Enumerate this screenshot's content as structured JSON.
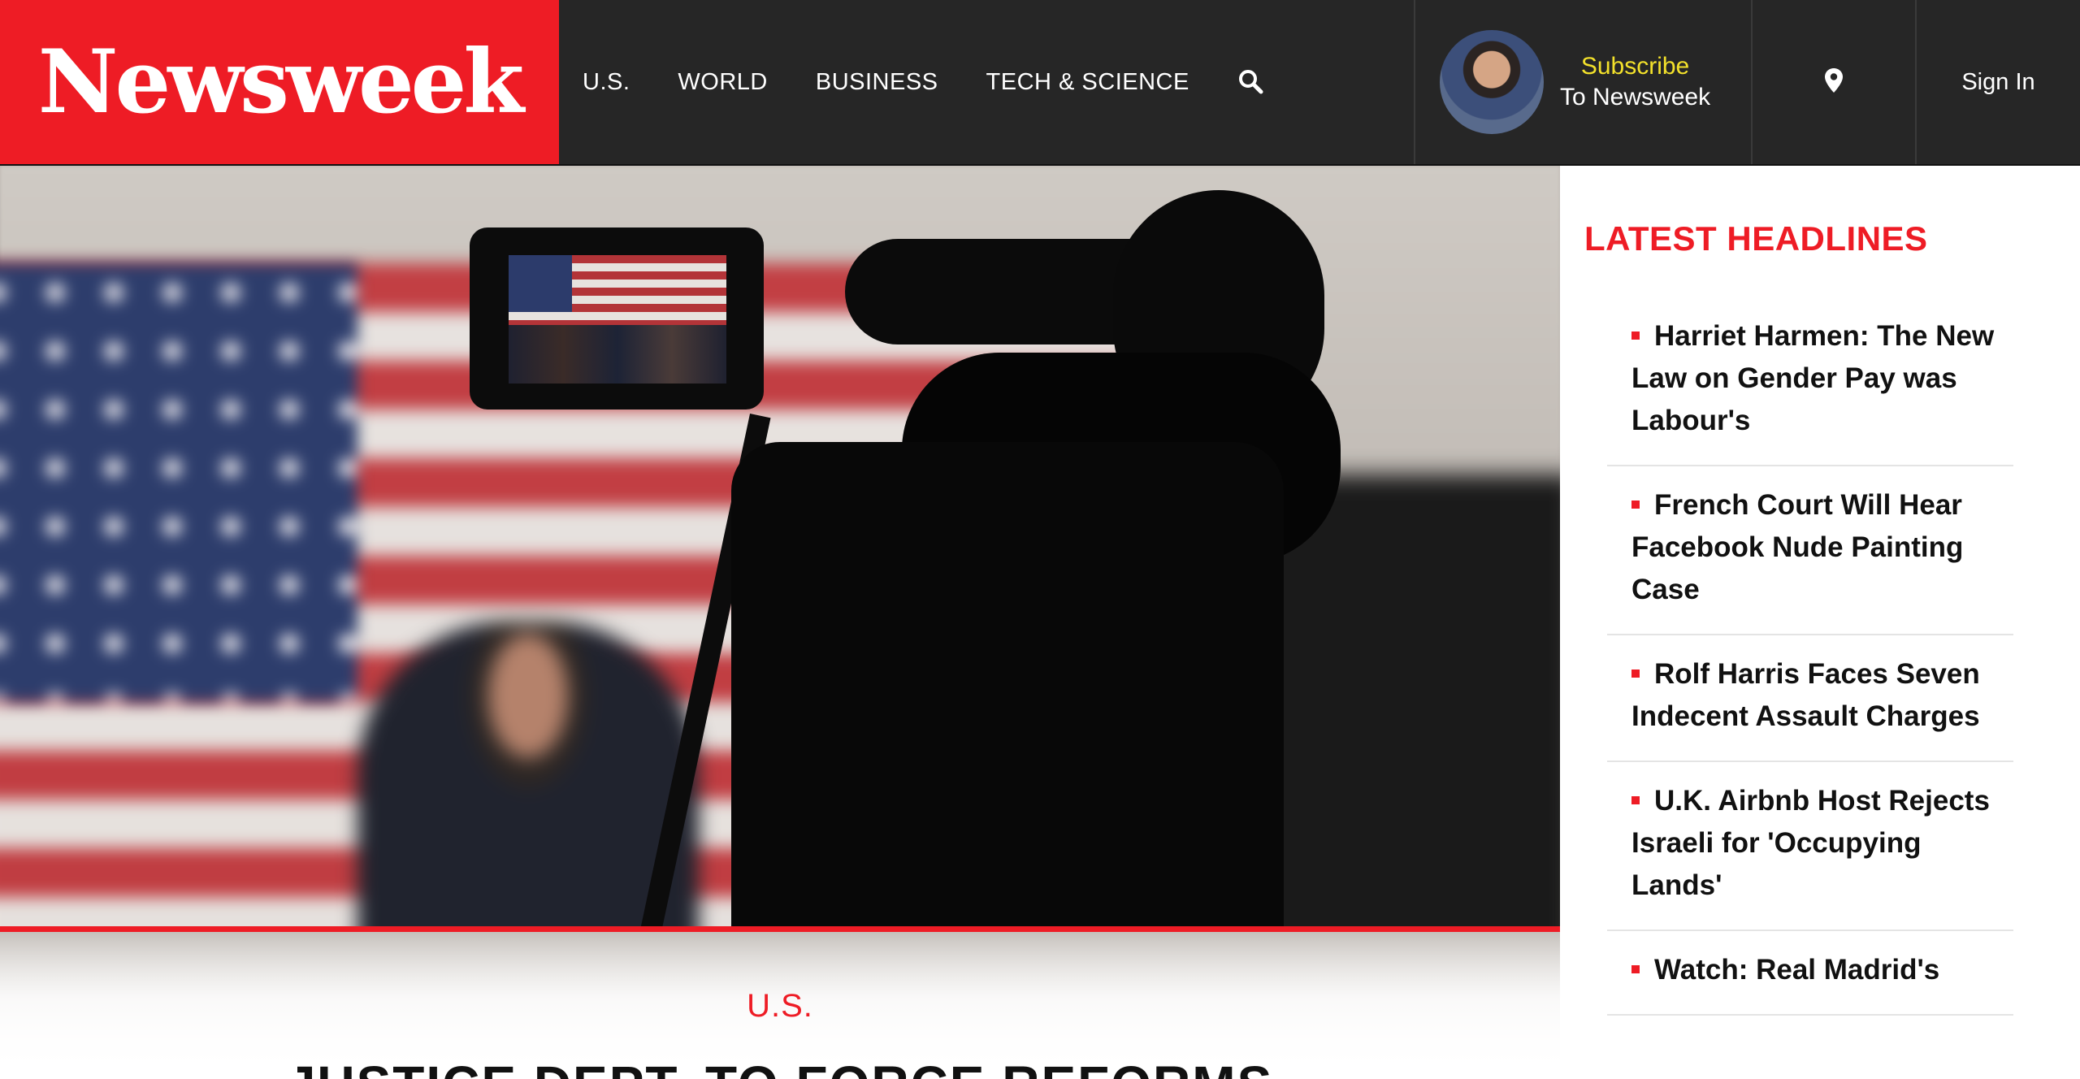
{
  "header": {
    "logo": "Newsweek",
    "nav": [
      {
        "label": "U.S."
      },
      {
        "label": "WORLD"
      },
      {
        "label": "BUSINESS"
      },
      {
        "label": "TECH & SCIENCE"
      }
    ],
    "search_icon": "search-icon",
    "subscribe": {
      "line1": "Subscribe",
      "line2": "To Newsweek"
    },
    "location_icon": "map-pin-icon",
    "sign_in": "Sign In"
  },
  "hero": {
    "section": "U.S.",
    "title": "JUSTICE DEPT. TO FORCE REFORMS"
  },
  "sidebar": {
    "title": "LATEST HEADLINES",
    "headlines": [
      "Harriet Harmen: The New Law on Gender Pay was Labour's",
      "French Court Will Hear Facebook Nude Painting Case",
      "Rolf Harris Faces Seven Indecent Assault Charges",
      "U.K. Airbnb Host Rejects Israeli for 'Occupying Lands'",
      "Watch: Real Madrid's"
    ]
  },
  "colors": {
    "brand_red": "#ee1c25",
    "header_bg": "#262626",
    "subscribe_accent": "#f3e12b"
  }
}
